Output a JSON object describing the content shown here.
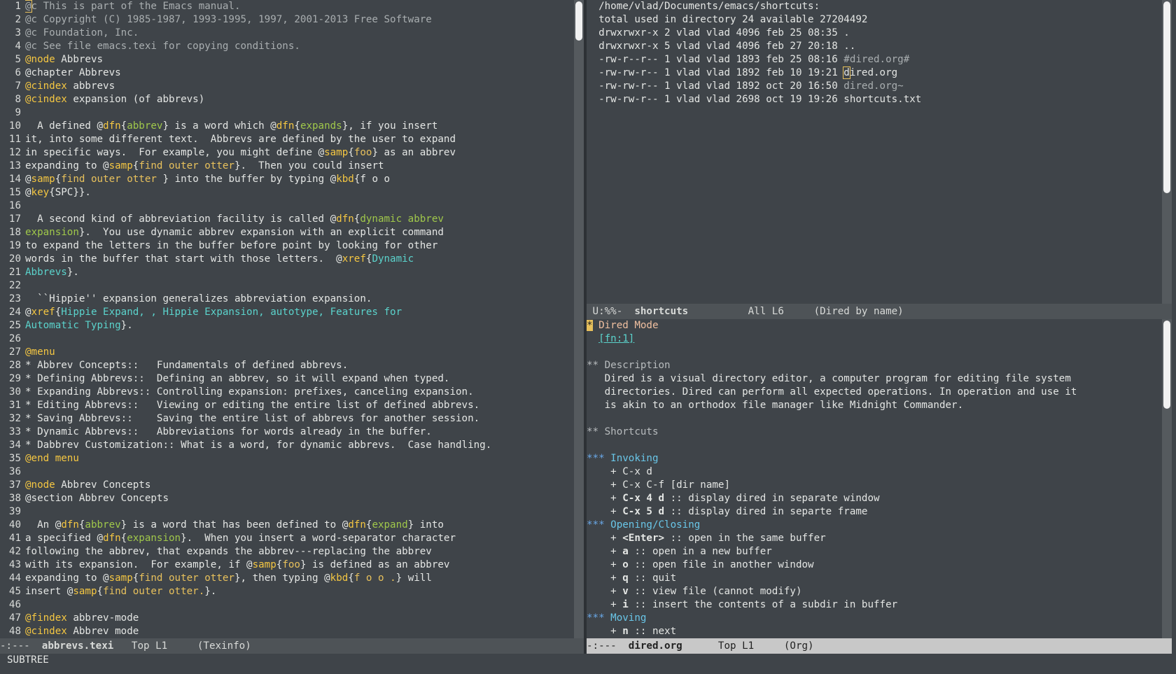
{
  "left": {
    "line_numbers": [
      "1",
      "2",
      "3",
      "4",
      "5",
      "6",
      "7",
      "8",
      "9",
      "10",
      "11",
      "12",
      "13",
      "14",
      "15",
      "16",
      "17",
      "18",
      "19",
      "20",
      "21",
      "22",
      "23",
      "24",
      "25",
      "26",
      "27",
      "28",
      "29",
      "30",
      "31",
      "32",
      "33",
      "34",
      "35",
      "36",
      "37",
      "38",
      "39",
      "40",
      "41",
      "42",
      "43",
      "44",
      "45",
      "46",
      "47",
      "48"
    ],
    "lines": [
      [
        {
          "t": "@c This is part of the Emacs manual.",
          "c": "cmt"
        }
      ],
      [
        {
          "t": "@c Copyright (C) 1985-1987, 1993-1995, 1997, 2001-2013 Free Software",
          "c": "cmt"
        }
      ],
      [
        {
          "t": "@c Foundation, Inc.",
          "c": "cmt"
        }
      ],
      [
        {
          "t": "@c See file emacs.texi for copying conditions.",
          "c": "cmt"
        }
      ],
      [
        {
          "t": "@node",
          "c": "kw"
        },
        {
          "t": " Abbrevs"
        }
      ],
      [
        {
          "t": "@chapter Abbrevs"
        }
      ],
      [
        {
          "t": "@cindex",
          "c": "kw"
        },
        {
          "t": " abbrevs"
        }
      ],
      [
        {
          "t": "@cindex",
          "c": "kw"
        },
        {
          "t": " expansion (of abbrevs)"
        }
      ],
      [],
      [
        {
          "t": "  A defined @"
        },
        {
          "t": "dfn",
          "c": "kw"
        },
        {
          "t": "{"
        },
        {
          "t": "abbrev",
          "c": "dfn"
        },
        {
          "t": "} is a word which @"
        },
        {
          "t": "dfn",
          "c": "kw"
        },
        {
          "t": "{"
        },
        {
          "t": "expands",
          "c": "dfn"
        },
        {
          "t": "}, if you insert"
        }
      ],
      [
        {
          "t": "it, into some different text.  Abbrevs are defined by the user to expand"
        }
      ],
      [
        {
          "t": "in specific ways.  For example, you might define @"
        },
        {
          "t": "samp",
          "c": "kw"
        },
        {
          "t": "{"
        },
        {
          "t": "foo",
          "c": "arg"
        },
        {
          "t": "} as an abbrev"
        }
      ],
      [
        {
          "t": "expanding to @"
        },
        {
          "t": "samp",
          "c": "kw"
        },
        {
          "t": "{"
        },
        {
          "t": "find outer otter",
          "c": "arg"
        },
        {
          "t": "}.  Then you could insert"
        }
      ],
      [
        {
          "t": "@"
        },
        {
          "t": "samp",
          "c": "kw"
        },
        {
          "t": "{"
        },
        {
          "t": "find outer otter ",
          "c": "arg"
        },
        {
          "t": "} into the buffer by typing @"
        },
        {
          "t": "kbd",
          "c": "kw"
        },
        {
          "t": "{f o o"
        }
      ],
      [
        {
          "t": "@"
        },
        {
          "t": "key",
          "c": "kw"
        },
        {
          "t": "{SPC}}."
        }
      ],
      [],
      [
        {
          "t": "  A second kind of abbreviation facility is called @"
        },
        {
          "t": "dfn",
          "c": "kw"
        },
        {
          "t": "{"
        },
        {
          "t": "dynamic abbrev",
          "c": "dfn"
        }
      ],
      [
        {
          "t": "expansion",
          "c": "dfn"
        },
        {
          "t": "}.  You use dynamic abbrev expansion with an explicit command"
        }
      ],
      [
        {
          "t": "to expand the letters in the buffer before point by looking for other"
        }
      ],
      [
        {
          "t": "words in the buffer that start with those letters.  @"
        },
        {
          "t": "xref",
          "c": "kw"
        },
        {
          "t": "{"
        },
        {
          "t": "Dynamic",
          "c": "xref"
        }
      ],
      [
        {
          "t": "Abbrevs",
          "c": "xref"
        },
        {
          "t": "}."
        }
      ],
      [],
      [
        {
          "t": "  ``Hippie'' expansion generalizes abbreviation expansion."
        }
      ],
      [
        {
          "t": "@"
        },
        {
          "t": "xref",
          "c": "kw"
        },
        {
          "t": "{"
        },
        {
          "t": "Hippie Expand, , Hippie Expansion, autotype, Features for",
          "c": "xref"
        }
      ],
      [
        {
          "t": "Automatic Typing",
          "c": "xref"
        },
        {
          "t": "}."
        }
      ],
      [],
      [
        {
          "t": "@menu",
          "c": "kw"
        }
      ],
      [
        {
          "t": "* Abbrev Concepts::   Fundamentals of defined abbrevs."
        }
      ],
      [
        {
          "t": "* Defining Abbrevs::  Defining an abbrev, so it will expand when typed."
        }
      ],
      [
        {
          "t": "* Expanding Abbrevs:: Controlling expansion: prefixes, canceling expansion."
        }
      ],
      [
        {
          "t": "* Editing Abbrevs::   Viewing or editing the entire list of defined abbrevs."
        }
      ],
      [
        {
          "t": "* Saving Abbrevs::    Saving the entire list of abbrevs for another session."
        }
      ],
      [
        {
          "t": "* Dynamic Abbrevs::   Abbreviations for words already in the buffer."
        }
      ],
      [
        {
          "t": "* Dabbrev Customization:: What is a word, for dynamic abbrevs.  Case handling."
        }
      ],
      [
        {
          "t": "@end menu",
          "c": "kw"
        }
      ],
      [],
      [
        {
          "t": "@node",
          "c": "kw"
        },
        {
          "t": " Abbrev Concepts"
        }
      ],
      [
        {
          "t": "@section Abbrev Concepts"
        }
      ],
      [],
      [
        {
          "t": "  An @"
        },
        {
          "t": "dfn",
          "c": "kw"
        },
        {
          "t": "{"
        },
        {
          "t": "abbrev",
          "c": "dfn"
        },
        {
          "t": "} is a word that has been defined to @"
        },
        {
          "t": "dfn",
          "c": "kw"
        },
        {
          "t": "{"
        },
        {
          "t": "expand",
          "c": "dfn"
        },
        {
          "t": "} into"
        }
      ],
      [
        {
          "t": "a specified @"
        },
        {
          "t": "dfn",
          "c": "kw"
        },
        {
          "t": "{"
        },
        {
          "t": "expansion",
          "c": "dfn"
        },
        {
          "t": "}.  When you insert a word-separator character"
        }
      ],
      [
        {
          "t": "following the abbrev, that expands the abbrev---replacing the abbrev"
        }
      ],
      [
        {
          "t": "with its expansion.  For example, if @"
        },
        {
          "t": "samp",
          "c": "kw"
        },
        {
          "t": "{"
        },
        {
          "t": "foo",
          "c": "arg"
        },
        {
          "t": "} is defined as an abbrev"
        }
      ],
      [
        {
          "t": "expanding to @"
        },
        {
          "t": "samp",
          "c": "kw"
        },
        {
          "t": "{"
        },
        {
          "t": "find outer otter",
          "c": "arg"
        },
        {
          "t": "}, then typing @"
        },
        {
          "t": "kbd",
          "c": "kw"
        },
        {
          "t": "{"
        },
        {
          "t": "f o o .",
          "c": "arg"
        },
        {
          "t": "} will"
        }
      ],
      [
        {
          "t": "insert @"
        },
        {
          "t": "samp",
          "c": "kw"
        },
        {
          "t": "{"
        },
        {
          "t": "find outer otter.",
          "c": "arg"
        },
        {
          "t": "}."
        }
      ],
      [],
      [
        {
          "t": "@findex",
          "c": "kw"
        },
        {
          "t": " abbrev-mode"
        }
      ],
      [
        {
          "t": "@cindex",
          "c": "kw"
        },
        {
          "t": " Abbrev mode"
        }
      ]
    ],
    "modeline": {
      "status": "-:---  ",
      "buffer": "abbrevs.texi",
      "position": "   Top L1",
      "mode": "     (Texinfo)"
    }
  },
  "dired": {
    "lines": [
      [
        {
          "t": "  /home/vlad/Documents/emacs/shortcuts:"
        }
      ],
      [
        {
          "t": "  total used in directory 24 available 27204492"
        }
      ],
      [
        {
          "t": "  drwxrwxr-x 2 vlad vlad 4096 feb 25 08:35 ."
        }
      ],
      [
        {
          "t": "  drwxrwxr-x 5 vlad vlad 4096 feb 27 20:18 .."
        }
      ],
      [
        {
          "t": "  -rw-r--r-- 1 vlad vlad 1893 feb 25 08:16 "
        },
        {
          "t": "#dired.org#",
          "c": "dim"
        }
      ],
      [
        {
          "t": "  -rw-rw-r-- 1 vlad vlad 1892 feb 10 19:21 "
        },
        {
          "t": "d",
          "c": "cursor"
        },
        {
          "t": "ired.org"
        }
      ],
      [
        {
          "t": "  -rw-rw-r-- 1 vlad vlad 1892 oct 20 16:50 "
        },
        {
          "t": "dired.org~",
          "c": "dim"
        }
      ],
      [
        {
          "t": "  -rw-rw-r-- 1 vlad vlad 2698 oct 19 19:26 shortcuts.txt"
        }
      ]
    ],
    "modeline": {
      "status": " U:%%-  ",
      "buffer": "shortcuts",
      "position": "          All L6",
      "mode": "     (Dired by name)"
    }
  },
  "org": {
    "lines": [
      [
        {
          "t": "*",
          "c": "org-star1"
        },
        {
          "t": " Dired Mode",
          "c": "org-h1"
        }
      ],
      [
        {
          "t": "  "
        },
        {
          "t": "[fn:1]",
          "c": "org-link"
        }
      ],
      [],
      [
        {
          "t": "** Description",
          "c": "org-h2"
        }
      ],
      [
        {
          "t": "   Dired is a visual directory editor, a computer program for editing file system"
        }
      ],
      [
        {
          "t": "   directories. Dired can perform all expected operations. In operation and use it"
        }
      ],
      [
        {
          "t": "   is akin to an orthodox file manager like Midnight Commander."
        }
      ],
      [],
      [
        {
          "t": "** Shortcuts",
          "c": "org-h2"
        }
      ],
      [],
      [
        {
          "t": "*** ",
          "c": "org-h3star"
        },
        {
          "t": "Invoking",
          "c": "org-h3"
        }
      ],
      [
        {
          "t": "    + C-x d"
        }
      ],
      [
        {
          "t": "    + C-x C-f [dir name]"
        }
      ],
      [
        {
          "t": "    + "
        },
        {
          "t": "C-x 4 d",
          "c": "bold"
        },
        {
          "t": " :: display dired in separate window"
        }
      ],
      [
        {
          "t": "    + "
        },
        {
          "t": "C-x 5 d",
          "c": "bold"
        },
        {
          "t": " :: display dired in separte frame"
        }
      ],
      [
        {
          "t": "*** ",
          "c": "org-h3star"
        },
        {
          "t": "Opening/Closing",
          "c": "org-h3"
        }
      ],
      [
        {
          "t": "    + "
        },
        {
          "t": "<Enter>",
          "c": "bold"
        },
        {
          "t": " :: open in the same buffer"
        }
      ],
      [
        {
          "t": "    + "
        },
        {
          "t": "a",
          "c": "bold"
        },
        {
          "t": " :: open in a new buffer"
        }
      ],
      [
        {
          "t": "    + "
        },
        {
          "t": "o",
          "c": "bold"
        },
        {
          "t": " :: open file in another window"
        }
      ],
      [
        {
          "t": "    + "
        },
        {
          "t": "q",
          "c": "bold"
        },
        {
          "t": " :: quit"
        }
      ],
      [
        {
          "t": "    + "
        },
        {
          "t": "v",
          "c": "bold"
        },
        {
          "t": " :: view file (cannot modify)"
        }
      ],
      [
        {
          "t": "    + "
        },
        {
          "t": "i",
          "c": "bold"
        },
        {
          "t": " :: insert the contents of a subdir in buffer"
        }
      ],
      [
        {
          "t": "*** ",
          "c": "org-h3star"
        },
        {
          "t": "Moving",
          "c": "org-h3"
        }
      ],
      [
        {
          "t": "    + "
        },
        {
          "t": "n",
          "c": "bold"
        },
        {
          "t": " :: next"
        }
      ]
    ],
    "modeline": {
      "status": "-:---  ",
      "buffer": "dired.org",
      "position": "      Top L1",
      "mode": "     (Org)"
    }
  },
  "echo_area": "SUBTREE"
}
